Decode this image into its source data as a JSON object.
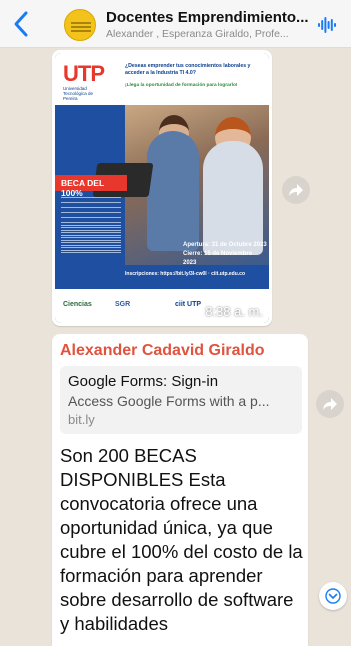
{
  "header": {
    "title": "Docentes Emprendimiento...",
    "subtitle": "Alexander , Esperanza Giraldo, Profe..."
  },
  "image_message": {
    "flyer": {
      "logo": "UTP",
      "logo_sub": "Universidad Tecnológica de Pereira",
      "tagline": "¿Deseas emprender tus conocimientos laborales y acceder a la Industria TI 4.0?",
      "tagline2": "¡Llega la oportunidad de formación para lograrlo!",
      "beca": "BECA DEL 100%",
      "apertura": "Apertura: 31 de Octubre 2023",
      "cierre": "Cierre: 15 de Noviembre 2023",
      "link": "Inscripciones: https://bit.ly/3I-cw0l · ciit.utp.edu.co",
      "partner1": "Ciencias",
      "partner2": "SGR",
      "partner3": "ciit UTP"
    },
    "time": "8:38 a. m."
  },
  "text_message": {
    "sender": "Alexander  Cadavid Giraldo",
    "link_preview": {
      "title": "Google Forms: Sign-in",
      "description": "Access Google Forms with a p...",
      "domain": "bit.ly"
    },
    "body": "Son 200 BECAS DISPONIBLES Esta convocatoria ofrece una oportunidad única, ya que cubre el 100% del costo de la formación para aprender sobre desarrollo de software y habilidades"
  },
  "colors": {
    "sender_name": "#e0533f",
    "accent_blue": "#1a7cf5",
    "chat_bg": "#e9e3da"
  }
}
